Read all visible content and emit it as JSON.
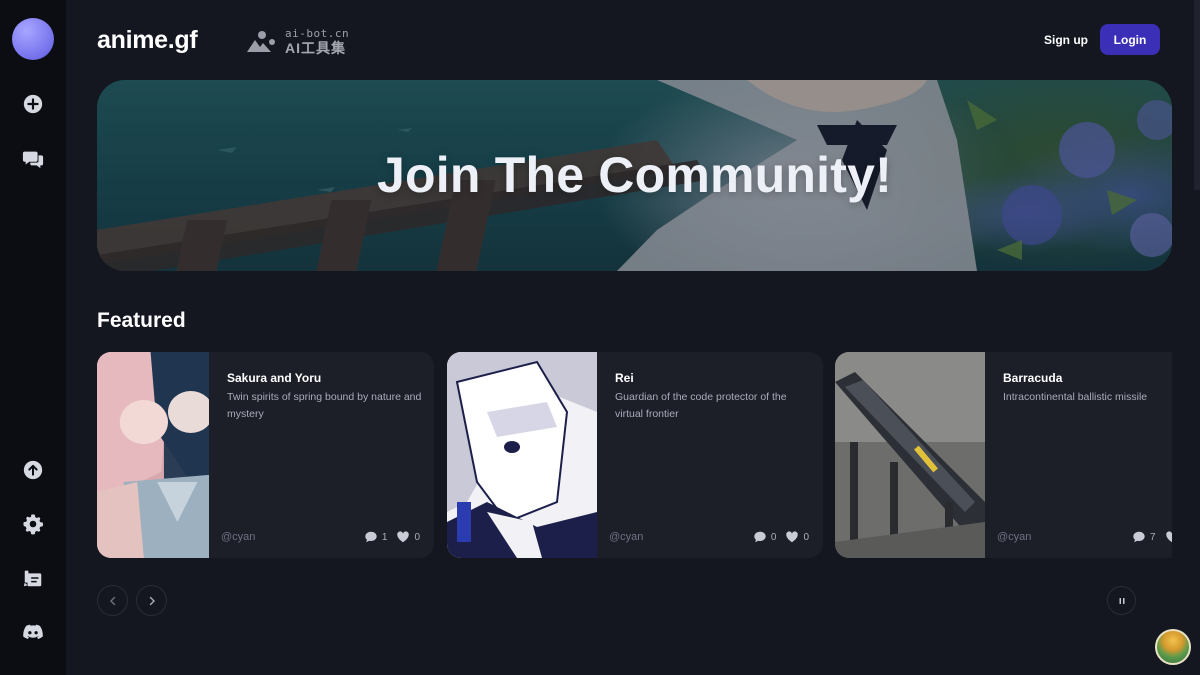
{
  "app": {
    "brand": "anime.gf",
    "watermark": {
      "line1": "ai-bot.cn",
      "line2": "AI工具集"
    }
  },
  "header": {
    "signup_label": "Sign up",
    "login_label": "Login",
    "login_color": "#3b2fb7"
  },
  "sidebar": {
    "items": [
      {
        "icon": "plus-circle-icon"
      },
      {
        "icon": "chat-bubbles-icon"
      },
      {
        "icon": "arrow-up-circle-icon"
      },
      {
        "icon": "gear-icon"
      },
      {
        "icon": "edit-cards-icon"
      },
      {
        "icon": "discord-icon"
      }
    ]
  },
  "hero": {
    "title": "Join The Community!"
  },
  "featured": {
    "title": "Featured",
    "cards": [
      {
        "title": "Sakura and Yoru",
        "description": "Twin spirits of spring bound by nature and mystery",
        "author": "@cyan",
        "comments": "1",
        "likes": "0"
      },
      {
        "title": "Rei",
        "description": "Guardian of the code protector of the virtual frontier",
        "author": "@cyan",
        "comments": "0",
        "likes": "0"
      },
      {
        "title": "Barracuda",
        "description": "Intracontinental ballistic missile",
        "author": "@cyan",
        "comments": "7",
        "likes": ""
      }
    ]
  },
  "colors": {
    "background": "#141620",
    "sidebar": "#0c0d13",
    "card": "#1c1e28",
    "accent": "#3b2fb7"
  }
}
